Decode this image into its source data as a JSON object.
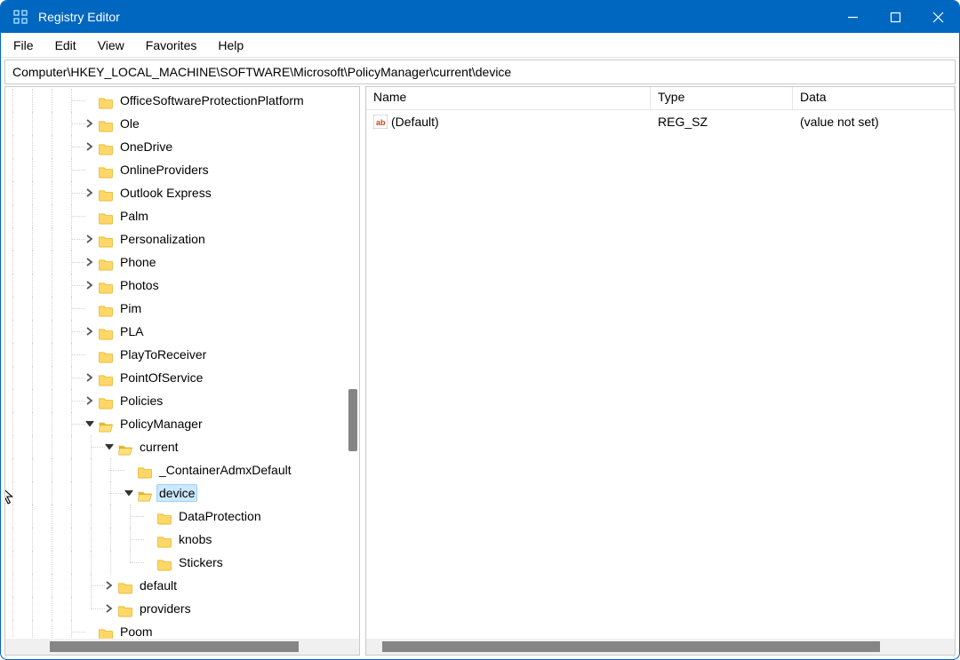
{
  "window": {
    "title": "Registry Editor"
  },
  "menu": {
    "items": [
      "File",
      "Edit",
      "View",
      "Favorites",
      "Help"
    ]
  },
  "address": {
    "path": "Computer\\HKEY_LOCAL_MACHINE\\SOFTWARE\\Microsoft\\PolicyManager\\current\\device"
  },
  "tree": {
    "nodes": [
      {
        "depth": 3,
        "label": "OfficeSoftwareProtectionPlatform",
        "expandable": false
      },
      {
        "depth": 3,
        "label": "Ole",
        "expandable": true
      },
      {
        "depth": 3,
        "label": "OneDrive",
        "expandable": true
      },
      {
        "depth": 3,
        "label": "OnlineProviders",
        "expandable": false
      },
      {
        "depth": 3,
        "label": "Outlook Express",
        "expandable": true
      },
      {
        "depth": 3,
        "label": "Palm",
        "expandable": false
      },
      {
        "depth": 3,
        "label": "Personalization",
        "expandable": true
      },
      {
        "depth": 3,
        "label": "Phone",
        "expandable": true
      },
      {
        "depth": 3,
        "label": "Photos",
        "expandable": true
      },
      {
        "depth": 3,
        "label": "Pim",
        "expandable": false
      },
      {
        "depth": 3,
        "label": "PLA",
        "expandable": true
      },
      {
        "depth": 3,
        "label": "PlayToReceiver",
        "expandable": false
      },
      {
        "depth": 3,
        "label": "PointOfService",
        "expandable": true
      },
      {
        "depth": 3,
        "label": "Policies",
        "expandable": true
      },
      {
        "depth": 3,
        "label": "PolicyManager",
        "expandable": true,
        "expanded": true
      },
      {
        "depth": 4,
        "label": "current",
        "expandable": true,
        "expanded": true
      },
      {
        "depth": 5,
        "label": "_ContainerAdmxDefault",
        "expandable": false
      },
      {
        "depth": 5,
        "label": "device",
        "expandable": true,
        "expanded": true,
        "selected": true
      },
      {
        "depth": 6,
        "label": "DataProtection",
        "expandable": false
      },
      {
        "depth": 6,
        "label": "knobs",
        "expandable": false
      },
      {
        "depth": 6,
        "label": "Stickers",
        "expandable": false,
        "last": true
      },
      {
        "depth": 4,
        "label": "default",
        "expandable": true
      },
      {
        "depth": 4,
        "label": "providers",
        "expandable": true,
        "last": true
      },
      {
        "depth": 3,
        "label": "Poom",
        "expandable": false
      }
    ]
  },
  "values": {
    "columns": {
      "name": "Name",
      "type": "Type",
      "data": "Data"
    },
    "rows": [
      {
        "name": "(Default)",
        "type": "REG_SZ",
        "data": "(value not set)",
        "icon": "string"
      }
    ]
  }
}
